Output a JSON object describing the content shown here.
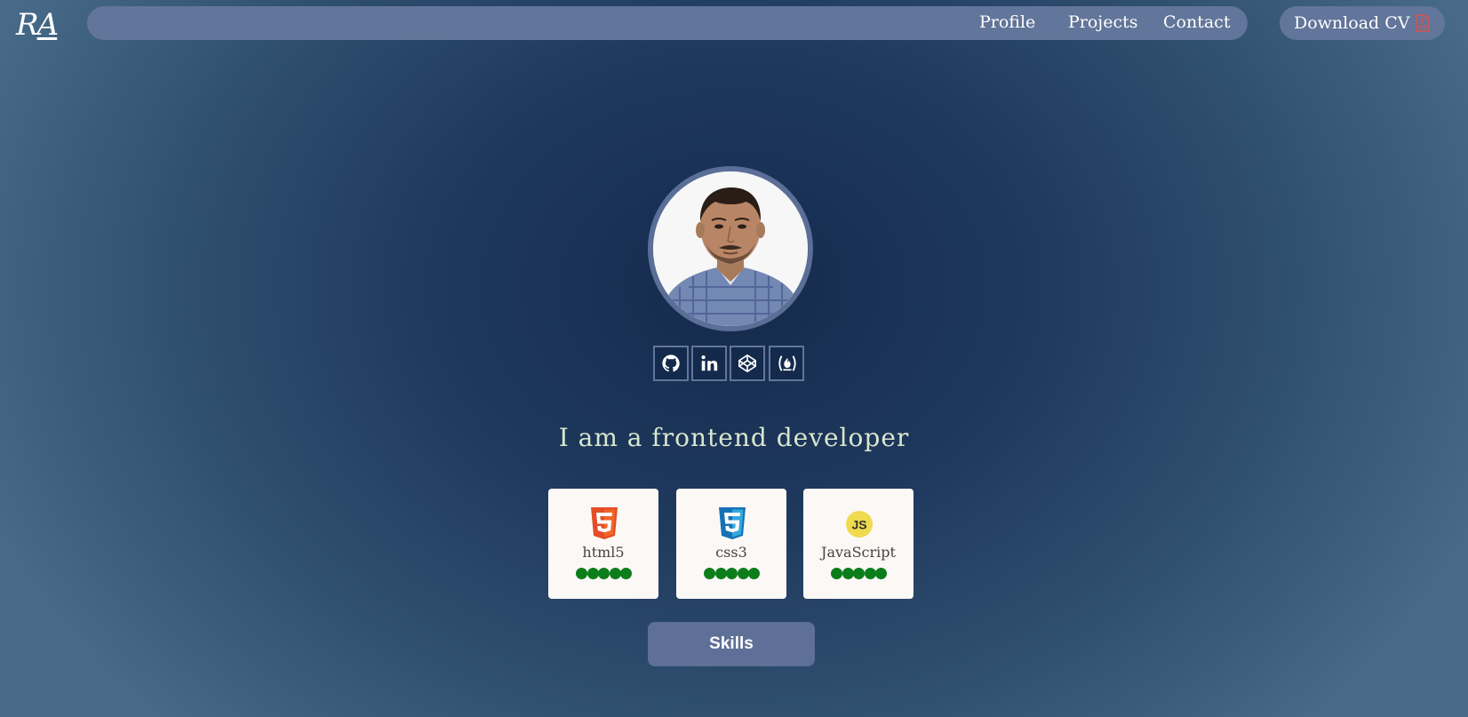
{
  "brand": {
    "logo_text_r": "R",
    "logo_text_a": "A"
  },
  "nav": {
    "items": [
      {
        "label": "Profile"
      },
      {
        "label": "Projects"
      },
      {
        "label": "Contact"
      }
    ],
    "download_label": "Download CV",
    "download_icon": "pdf-file-icon"
  },
  "profile": {
    "avatar_alt": "profile-photo",
    "socials": [
      {
        "name": "github-icon"
      },
      {
        "name": "linkedin-icon"
      },
      {
        "name": "codepen-icon"
      },
      {
        "name": "freecodecamp-icon"
      }
    ],
    "tagline": "I am a frontend developer"
  },
  "skills": {
    "cards": [
      {
        "name": "html5",
        "icon": "html5-icon",
        "rating": 5,
        "rating_max": 5
      },
      {
        "name": "css3",
        "icon": "css3-icon",
        "rating": 5,
        "rating_max": 5
      },
      {
        "name": "JavaScript",
        "icon": "javascript-icon",
        "rating": 5,
        "rating_max": 5
      }
    ],
    "button_label": "Skills"
  },
  "colors": {
    "nav_bg": "#62759a",
    "rating_dot": "#0b7d1a",
    "card_bg": "#fcf8f6",
    "tagline": "#d9e6cf",
    "html5": "#e44d26",
    "css3": "#1572b6",
    "javascript": "#f0db4f"
  }
}
